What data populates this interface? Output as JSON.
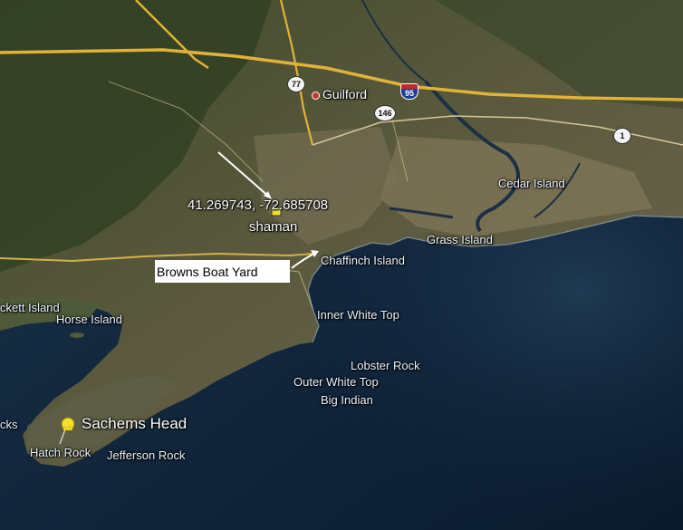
{
  "map": {
    "places": {
      "guilford": "Guilford",
      "cedar_island": "Cedar Island",
      "grass_island": "Grass Island",
      "chaffinch_island": "Chaffinch Island",
      "inner_white_top": "Inner White Top",
      "lobster_rock": "Lobster Rock",
      "outer_white_top": "Outer White Top",
      "big_indian": "Big Indian",
      "horse_island": "Horse Island",
      "kett_island": "ckett Island",
      "sachems_head": "Sachems Head",
      "hatch_rock": "Hatch Rock",
      "jefferson_rock": "Jefferson Rock",
      "rocks": "cks"
    },
    "routes": {
      "route_77": "77",
      "route_146": "146",
      "interstate_95": "95",
      "route_1": "1"
    },
    "placemark": {
      "coordinates": "41.269743, -72.685708",
      "name": "shaman"
    },
    "callout": {
      "text": "Browns Boat Yard"
    },
    "colors": {
      "highway": "#e0b23a",
      "road": "#d7c79a",
      "water": "#10243a",
      "land": "#5a5a3c",
      "pin": "#f2e02a"
    },
    "icons": {
      "placemark_pin": "pushpin-icon",
      "arrow": "arrow-icon"
    }
  }
}
